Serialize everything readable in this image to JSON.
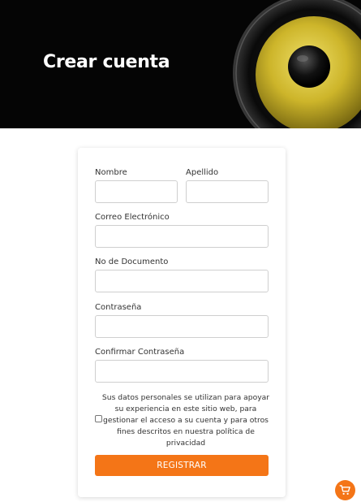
{
  "header": {
    "title": "Crear cuenta",
    "background_color": "#050505",
    "accent_color": "#d8c12e"
  },
  "form": {
    "nombre_label": "Nombre",
    "apellido_label": "Apellido",
    "email_label": "Correo Electrónico",
    "documento_label": "No de Documento",
    "password_label": "Contraseña",
    "confirm_password_label": "Confirmar Contraseña",
    "consent_text": "Sus datos personales se utilizan para apoyar su experiencia en este sitio web, para gestionar el acceso a su cuenta y para otros fines descritos en nuestra política de privacidad",
    "consent_checked": false,
    "submit_label": "REGISTRAR",
    "button_color": "#f47517"
  },
  "floating": {
    "cart_icon": "shopping-cart-icon"
  }
}
